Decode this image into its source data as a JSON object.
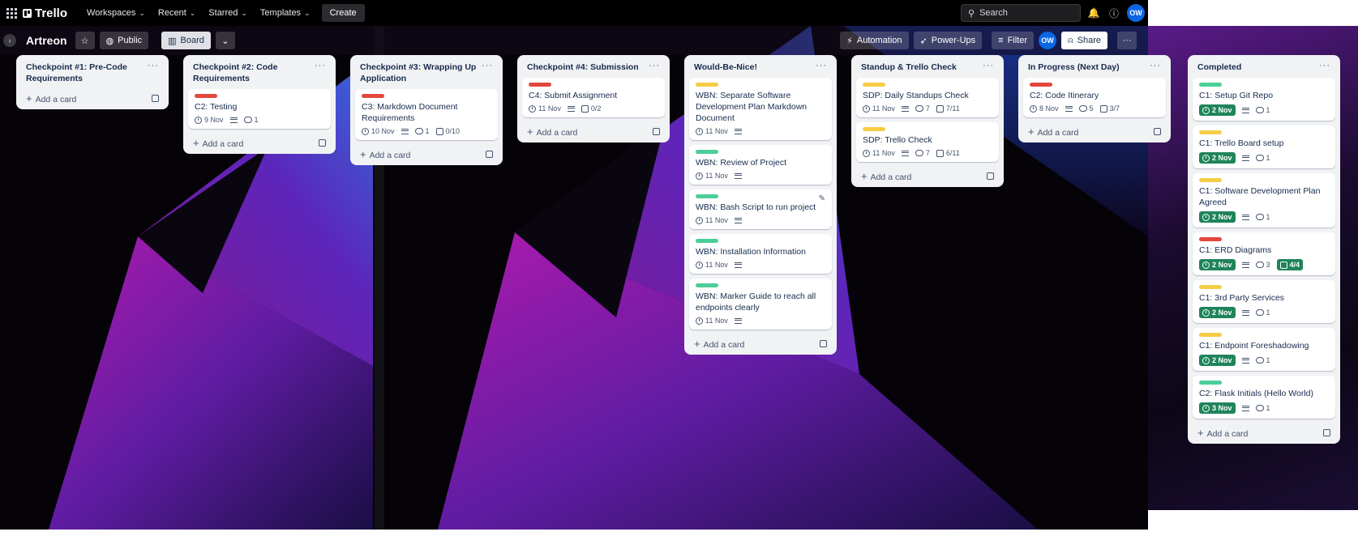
{
  "topnav": {
    "logo": "Trello",
    "menus": [
      "Workspaces",
      "Recent",
      "Starred",
      "Templates"
    ],
    "create": "Create",
    "search_placeholder": "Search",
    "avatar": "OW"
  },
  "board": {
    "title": "Artreon",
    "visibility": "Public",
    "view": "Board",
    "automation": "Automation",
    "powerups": "Power-Ups",
    "filter": "Filter",
    "member_avatar": "OW",
    "share": "Share"
  },
  "add_card": "Add a card",
  "colors": {
    "red": "#e2483d",
    "yellow": "#f5cd47",
    "green": "#4bce97",
    "done": "#1f845a",
    "accent_blue": "#0c66e4"
  },
  "lists": [
    {
      "title": "Checkpoint #1: Pre-Code Requirements",
      "cards": []
    },
    {
      "title": "Checkpoint #2: Code Requirements",
      "cards": [
        {
          "label": "red",
          "title": "C2: Testing",
          "due": "9 Nov",
          "desc": true,
          "comments": "1"
        }
      ]
    },
    {
      "title": "Checkpoint #3: Wrapping Up Application",
      "cards": [
        {
          "label": "red",
          "title": "C3: Markdown Document Requirements",
          "due": "10 Nov",
          "desc": true,
          "comments": "1",
          "checklist": "0/10"
        }
      ]
    },
    {
      "title": "Checkpoint #4: Submission",
      "cards": [
        {
          "label": "red",
          "title": "C4: Submit Assignment",
          "due": "11 Nov",
          "desc": true,
          "checklist": "0/2"
        }
      ]
    },
    {
      "title": "Would-Be-Nice!",
      "cards": [
        {
          "label": "yellow",
          "title": "WBN: Separate Software Development Plan Markdown Document",
          "due": "11 Nov",
          "desc": true
        },
        {
          "label": "green",
          "title": "WBN: Review of Project",
          "due": "11 Nov",
          "desc": true
        },
        {
          "label": "green",
          "title": "WBN: Bash Script to run project",
          "due": "11 Nov",
          "desc": true,
          "edit": true
        },
        {
          "label": "green",
          "title": "WBN: Installation Information",
          "due": "11 Nov",
          "desc": true
        },
        {
          "label": "green",
          "title": "WBN: Marker Guide to reach all endpoints clearly",
          "due": "11 Nov",
          "desc": true
        }
      ]
    },
    {
      "title": "Standup & Trello Check",
      "cards": [
        {
          "label": "yellow",
          "title": "SDP: Daily Standups Check",
          "due": "11 Nov",
          "desc": true,
          "comments": "7",
          "checklist": "7/11"
        },
        {
          "label": "yellow",
          "title": "SDP: Trello Check",
          "due": "11 Nov",
          "desc": true,
          "comments": "7",
          "checklist": "6/11"
        }
      ]
    },
    {
      "title": "In Progress (Next Day)",
      "cards": [
        {
          "label": "red",
          "title": "C2: Code Itinerary",
          "due": "8 Nov",
          "desc": true,
          "comments": "5",
          "checklist": "3/7"
        }
      ]
    },
    {
      "title": "Completed",
      "cards": [
        {
          "label": "green",
          "title": "C1: Setup Git Repo",
          "due": "2 Nov",
          "due_done": true,
          "desc": true,
          "comments": "1"
        },
        {
          "label": "yellow",
          "title": "C1: Trello Board setup",
          "due": "2 Nov",
          "due_done": true,
          "desc": true,
          "comments": "1"
        },
        {
          "label": "yellow",
          "title": "C1: Software Development Plan Agreed",
          "due": "2 Nov",
          "due_done": true,
          "desc": true,
          "comments": "1"
        },
        {
          "label": "red",
          "title": "C1: ERD Diagrams",
          "due": "2 Nov",
          "due_done": true,
          "desc": true,
          "comments": "3",
          "checklist": "4/4",
          "check_done": true
        },
        {
          "label": "yellow",
          "title": "C1: 3rd Party Services",
          "due": "2 Nov",
          "due_done": true,
          "desc": true,
          "comments": "1"
        },
        {
          "label": "yellow",
          "title": "C1: Endpoint Foreshadowing",
          "due": "2 Nov",
          "due_done": true,
          "desc": true,
          "comments": "1"
        },
        {
          "label": "green",
          "title": "C2: Flask Initials (Hello World)",
          "due": "3 Nov",
          "due_done": true,
          "desc": true,
          "comments": "1"
        }
      ]
    }
  ]
}
